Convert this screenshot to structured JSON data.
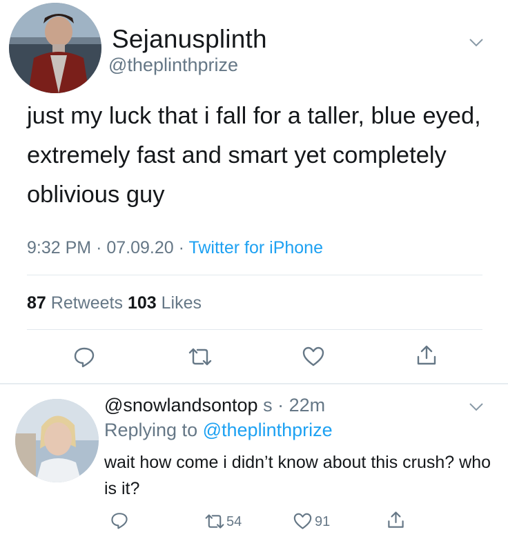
{
  "tweet": {
    "display_name": "Sejanusplinth",
    "handle": "@theplinthprize",
    "text": "just my luck that i fall for a taller, blue eyed, extremely fast and smart yet completely oblivious guy",
    "time": "9:32 PM",
    "date": "07.09.20",
    "source": "Twitter for iPhone",
    "meta_sep": "·",
    "retweets_count": "87",
    "retweets_label": "Retweets",
    "likes_count": "103",
    "likes_label": "Likes",
    "icons": [
      "chevron-down-icon",
      "reply-icon",
      "retweet-icon",
      "like-icon",
      "share-icon"
    ]
  },
  "reply": {
    "handle": "@snowlandsontop",
    "time": "s · 22m",
    "replying_prefix": "Replying to",
    "replying_to": "@theplinthprize",
    "text": "wait how come i didn’t know about this crush? who is it?",
    "retweet_count": "54",
    "like_count": "91"
  },
  "colors": {
    "text": "#14171a",
    "secondary": "#657786",
    "link": "#1da1f2",
    "divider": "#e1e8ed"
  }
}
